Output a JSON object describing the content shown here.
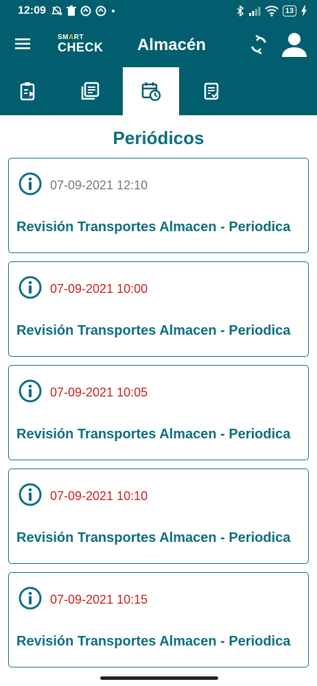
{
  "status_bar": {
    "time": "12:09",
    "battery": "13",
    "icons": [
      "alarm-off-icon",
      "trash-icon",
      "app-icon",
      "app-icon-2",
      "dot-icon",
      "bluetooth-icon",
      "signal-icon",
      "wifi-icon",
      "battery-icon",
      "charging-icon"
    ]
  },
  "app_bar": {
    "logo_line1_pre": "SM",
    "logo_line1_accent": "A",
    "logo_line1_post": "RT",
    "logo_line2": "CHECK",
    "title": "Almacén",
    "icons": [
      "menu-icon",
      "sync-icon",
      "user-icon"
    ]
  },
  "tabs": [
    {
      "icon": "clipboard-play-icon",
      "active": false
    },
    {
      "icon": "documents-icon",
      "active": false
    },
    {
      "icon": "calendar-clock-icon",
      "active": true
    },
    {
      "icon": "checklist-icon",
      "active": false
    }
  ],
  "section_title": "Periódicos",
  "cards": [
    {
      "date": "07-09-2021 12:10",
      "date_color": "#777777",
      "title": "Revisión Transportes Almacen - Periodica"
    },
    {
      "date": "07-09-2021 10:00",
      "date_color": "#cc1f1f",
      "title": "Revisión Transportes Almacen - Periodica"
    },
    {
      "date": "07-09-2021 10:05",
      "date_color": "#cc1f1f",
      "title": "Revisión Transportes Almacen - Periodica"
    },
    {
      "date": "07-09-2021 10:10",
      "date_color": "#cc1f1f",
      "title": "Revisión Transportes Almacen - Periodica"
    },
    {
      "date": "07-09-2021 10:15",
      "date_color": "#cc1f1f",
      "title": "Revisión Transportes Almacen - Periodica"
    }
  ],
  "colors": {
    "primary": "#005e6e",
    "accent_text": "#0c6e80",
    "overdue": "#cc1f1f",
    "neutral_date": "#777777"
  }
}
